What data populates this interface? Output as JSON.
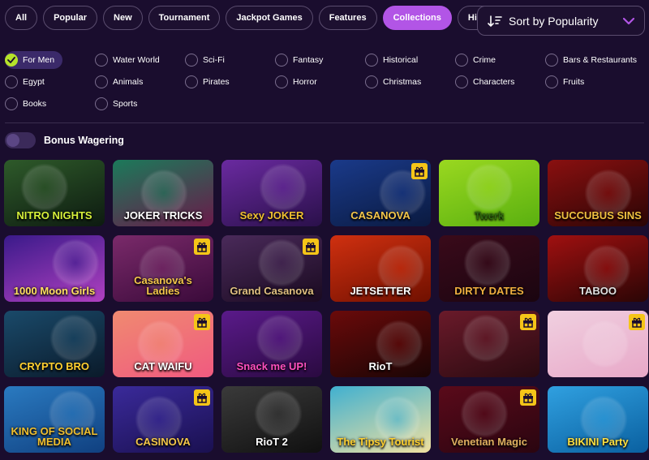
{
  "tabs": [
    {
      "label": "All",
      "active": false
    },
    {
      "label": "Popular",
      "active": false
    },
    {
      "label": "New",
      "active": false
    },
    {
      "label": "Tournament",
      "active": false
    },
    {
      "label": "Jackpot Games",
      "active": false
    },
    {
      "label": "Features",
      "active": false
    },
    {
      "label": "Collections",
      "active": true
    },
    {
      "label": "Highrollers",
      "active": false
    }
  ],
  "sort": {
    "label": "Sort by Popularity",
    "icon": "sort-icon",
    "dropdown_icon": "chevron-down-icon"
  },
  "collections": [
    {
      "label": "For Men",
      "checked": true
    },
    {
      "label": "Water World",
      "checked": false
    },
    {
      "label": "Sci-Fi",
      "checked": false
    },
    {
      "label": "Fantasy",
      "checked": false
    },
    {
      "label": "Historical",
      "checked": false
    },
    {
      "label": "Crime",
      "checked": false
    },
    {
      "label": "Bars & Restaurants",
      "checked": false
    },
    {
      "label": "Egypt",
      "checked": false
    },
    {
      "label": "Animals",
      "checked": false
    },
    {
      "label": "Pirates",
      "checked": false
    },
    {
      "label": "Horror",
      "checked": false
    },
    {
      "label": "Christmas",
      "checked": false
    },
    {
      "label": "Characters",
      "checked": false
    },
    {
      "label": "Fruits",
      "checked": false
    },
    {
      "label": "Books",
      "checked": false
    },
    {
      "label": "Sports",
      "checked": false
    }
  ],
  "bonus_wagering": {
    "label": "Bonus Wagering",
    "enabled": false
  },
  "colors": {
    "background": "#1a0d2e",
    "accent": "#b255e6",
    "checked": "#b6e32a",
    "gift": "#f5c518"
  },
  "games": [
    {
      "title": "NITRO NIGHTS",
      "gift": false,
      "bg": [
        "#2e5a2a",
        "#0d1a10"
      ],
      "color": "#d6f03a"
    },
    {
      "title": "JOKER TRICKS",
      "gift": false,
      "bg": [
        "#1b7a5a",
        "#6a1a4a"
      ],
      "color": "#ffffff"
    },
    {
      "title": "Sexy JOKER",
      "gift": false,
      "bg": [
        "#6a2aa0",
        "#2a104a"
      ],
      "color": "#f0c030"
    },
    {
      "title": "CASANOVA",
      "gift": true,
      "bg": [
        "#1a3a8a",
        "#0a1a40"
      ],
      "color": "#f3c64a"
    },
    {
      "title": "Twerk",
      "gift": false,
      "bg": [
        "#9ad820",
        "#5ab010"
      ],
      "color": "#2e6a10"
    },
    {
      "title": "SUCCUBUS SINS",
      "gift": false,
      "bg": [
        "#8a1010",
        "#2a0505"
      ],
      "color": "#f0c040"
    },
    {
      "title": "1000 Moon Girls",
      "gift": false,
      "bg": [
        "#3a1a8a",
        "#b040c0"
      ],
      "color": "#ffe060"
    },
    {
      "title": "Casanova's Ladies",
      "gift": true,
      "bg": [
        "#7a2a6a",
        "#3a0a3a"
      ],
      "color": "#f3c64a"
    },
    {
      "title": "Grand Casanova",
      "gift": true,
      "bg": [
        "#4a2a5a",
        "#1a0a20"
      ],
      "color": "#e0c080"
    },
    {
      "title": "JETSETTER",
      "gift": false,
      "bg": [
        "#d03010",
        "#701000"
      ],
      "color": "#ffffff"
    },
    {
      "title": "DIRTY DATES",
      "gift": false,
      "bg": [
        "#3a0a1a",
        "#1a0510"
      ],
      "color": "#f0b040"
    },
    {
      "title": "TABOO",
      "gift": false,
      "bg": [
        "#a01010",
        "#2a0505"
      ],
      "color": "#e0e0e0"
    },
    {
      "title": "CRYPTO BRO",
      "gift": false,
      "bg": [
        "#1a4a6a",
        "#0a1a2a"
      ],
      "color": "#ffd030"
    },
    {
      "title": "CAT WAIFU",
      "gift": true,
      "bg": [
        "#f08a70",
        "#f05a80"
      ],
      "color": "#ffffff"
    },
    {
      "title": "Snack me UP!",
      "gift": false,
      "bg": [
        "#5a1a8a",
        "#2a0a40"
      ],
      "color": "#ff50c0"
    },
    {
      "title": "RioT",
      "gift": false,
      "bg": [
        "#6a0a0a",
        "#1a0505"
      ],
      "color": "#ffffff"
    },
    {
      "title": "",
      "gift": true,
      "bg": [
        "#6a1a2a",
        "#2a0a10"
      ],
      "color": "#f0c040"
    },
    {
      "title": "",
      "gift": true,
      "bg": [
        "#f0d0e0",
        "#e8a8c8"
      ],
      "color": "#c02080"
    },
    {
      "title": "KING OF SOCIAL MEDIA",
      "gift": false,
      "bg": [
        "#2a7ac0",
        "#104080"
      ],
      "color": "#f0c030"
    },
    {
      "title": "CASINOVA",
      "gift": true,
      "bg": [
        "#3a2a9a",
        "#1a1050"
      ],
      "color": "#f3c64a"
    },
    {
      "title": "RioT 2",
      "gift": false,
      "bg": [
        "#3a3a3a",
        "#101010"
      ],
      "color": "#ffffff"
    },
    {
      "title": "The Tipsy Tourist",
      "gift": false,
      "bg": [
        "#40b0d0",
        "#f0e0a0"
      ],
      "color": "#ffd030"
    },
    {
      "title": "Venetian Magic",
      "gift": true,
      "bg": [
        "#5a0a1a",
        "#2a0510"
      ],
      "color": "#e0b060"
    },
    {
      "title": "BIKINI Party",
      "gift": false,
      "bg": [
        "#30a0e0",
        "#0a60a0"
      ],
      "color": "#ffe040"
    }
  ]
}
